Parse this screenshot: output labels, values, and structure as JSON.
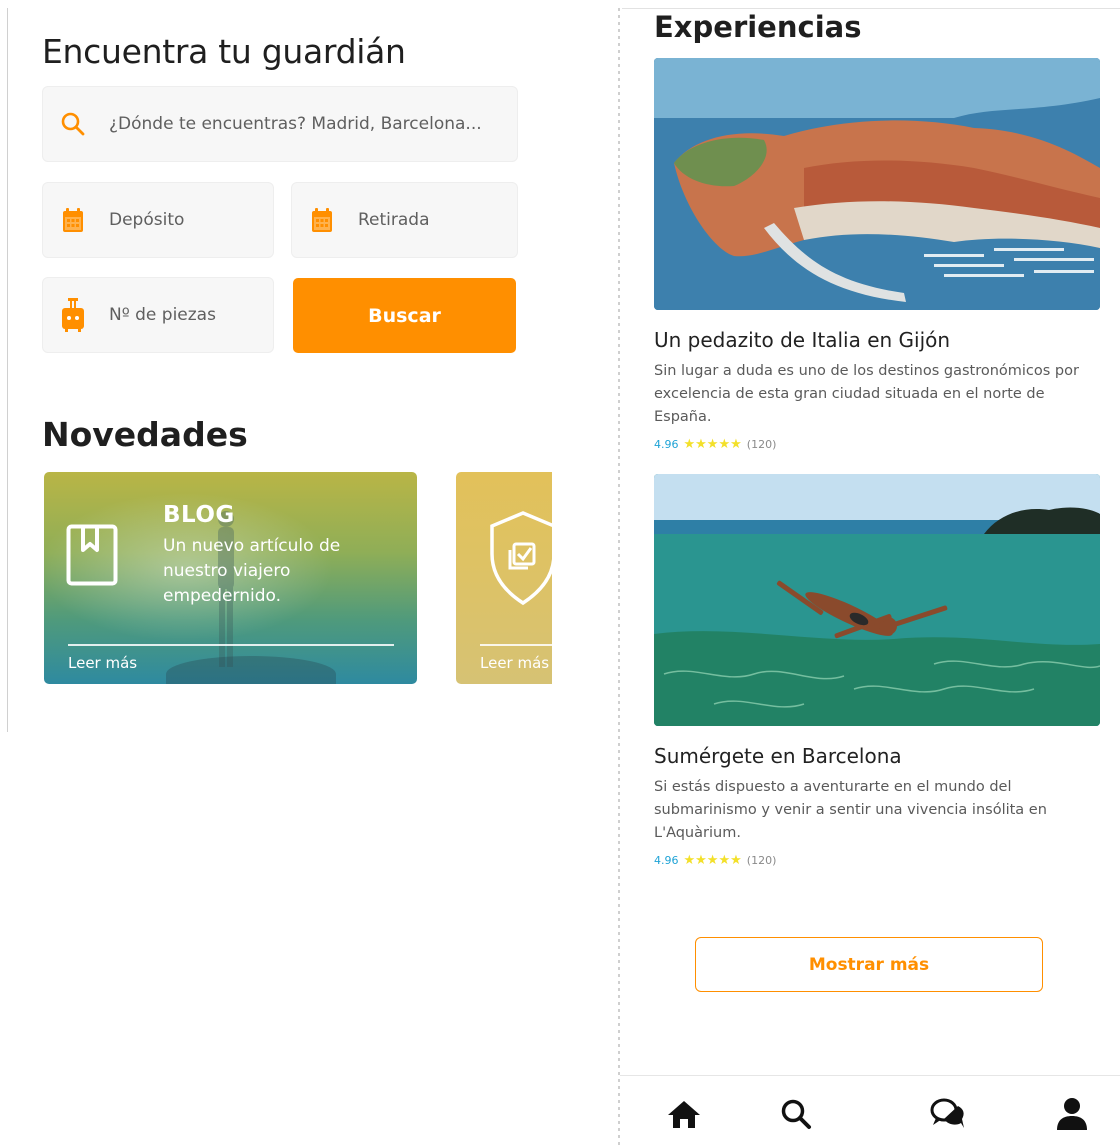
{
  "colors": {
    "accent": "#ff8f00",
    "rating_score": "#1fa3d6",
    "stars": "#f3e02a",
    "text_dark": "#1f1f1f",
    "text_muted": "#5a5a5a"
  },
  "search_screen": {
    "title": "Encuentra tu guardián",
    "location_placeholder": "¿Dónde te encuentras? Madrid, Barcelona...",
    "location_icon": "search-icon",
    "deposit_label": "Depósito",
    "deposit_icon": "calendar-icon",
    "pickup_label": "Retirada",
    "pickup_icon": "calendar-icon",
    "pieces_label": "Nº de piezas",
    "pieces_icon": "luggage-icon",
    "search_button": "Buscar",
    "news_title": "Novedades",
    "news_cards": [
      {
        "heading": "BLOG",
        "text": "Un nuevo artículo de nuestro viajero empedernido.",
        "link": "Leer más",
        "icon": "bookmark-icon"
      },
      {
        "link": "Leer más",
        "icon": "shield-check-icon"
      }
    ]
  },
  "experiences_screen": {
    "title": "Experiencias",
    "items": [
      {
        "name": "Un pedazito de Italia en Gijón",
        "description": "Sin lugar a duda es uno de los destinos gastronómicos por excelencia de esta gran ciudad situada en el norte de España.",
        "score": "4.96",
        "stars": "★★★★★",
        "reviews": "(120)"
      },
      {
        "name": "Sumérgete en Barcelona",
        "description": "Si estás dispuesto a aventurarte en el mundo del submarinismo y venir a sentir una vivencia insólita en L'Aquàrium.",
        "score": "4.96",
        "stars": "★★★★★",
        "reviews": "(120)"
      }
    ],
    "more_button": "Mostrar más",
    "bottom_nav": [
      "home-icon",
      "search-icon",
      "chat-icon",
      "profile-icon"
    ]
  }
}
